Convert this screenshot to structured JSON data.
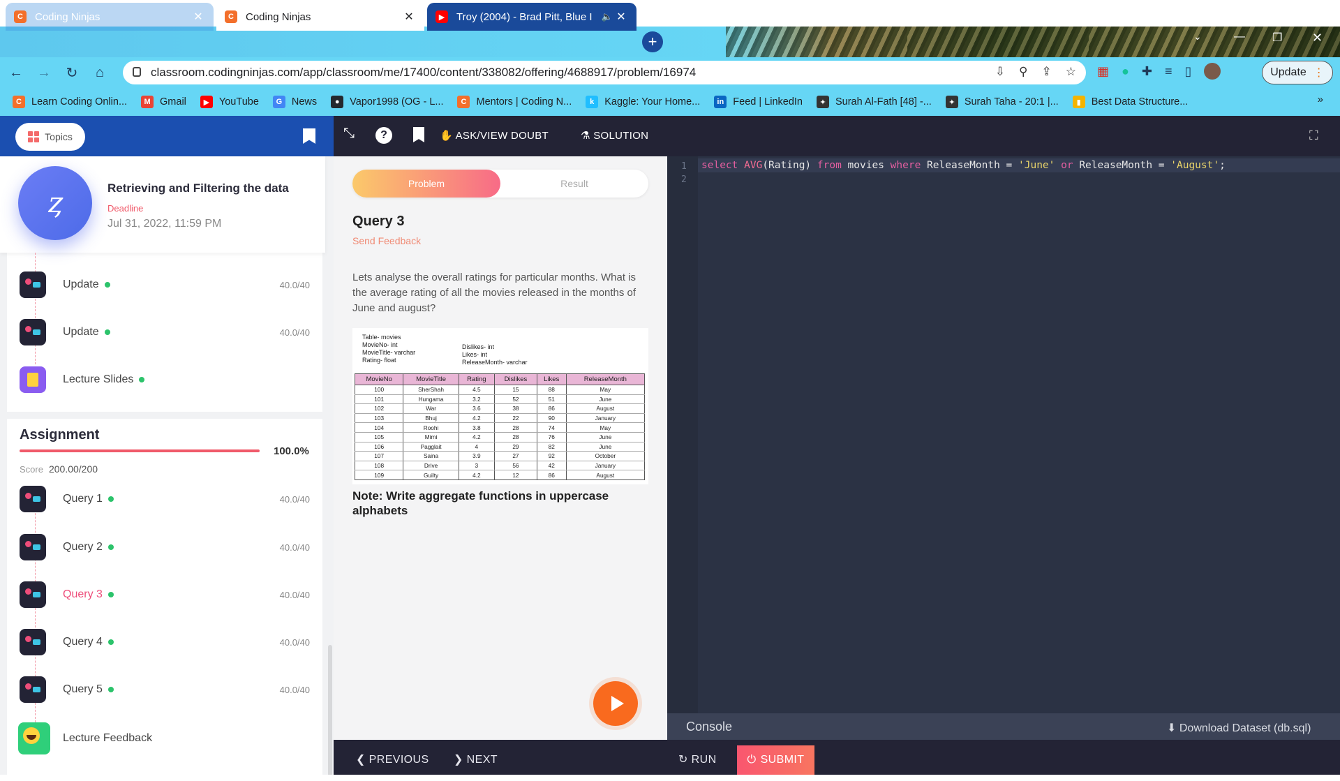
{
  "browser": {
    "tabs": [
      {
        "title": "Coding Ninjas",
        "favicon": "coding-ninjas-icon"
      },
      {
        "title": "Coding Ninjas",
        "favicon": "coding-ninjas-icon"
      },
      {
        "title": "Troy (2004) - Brad Pitt, Blue I",
        "favicon": "youtube-icon"
      }
    ],
    "url": "classroom.codingninjas.com/app/classroom/me/17400/content/338082/offering/4688917/problem/16974",
    "update_label": "Update",
    "bookmarks": [
      {
        "label": "Learn Coding Onlin...",
        "color": "#f36f2b",
        "glyph": "C"
      },
      {
        "label": "Gmail",
        "color": "#ea4335",
        "glyph": "M"
      },
      {
        "label": "YouTube",
        "color": "#ff0000",
        "glyph": "▶"
      },
      {
        "label": "News",
        "color": "#4285f4",
        "glyph": "G"
      },
      {
        "label": "Vapor1998 (OG - L...",
        "color": "#24292e",
        "glyph": "●"
      },
      {
        "label": "Mentors | Coding N...",
        "color": "#f36f2b",
        "glyph": "C"
      },
      {
        "label": "Kaggle: Your Home...",
        "color": "#20beff",
        "glyph": "k"
      },
      {
        "label": "Feed | LinkedIn",
        "color": "#0a66c2",
        "glyph": "in"
      },
      {
        "label": "Surah Al-Fath [48] -...",
        "color": "#333333",
        "glyph": "✦"
      },
      {
        "label": "Surah Taha - 20:1 |...",
        "color": "#333333",
        "glyph": "✦"
      },
      {
        "label": "Best Data Structure...",
        "color": "#f4b400",
        "glyph": "▮"
      }
    ]
  },
  "header": {
    "topics_label": "Topics",
    "ask_doubt": "ASK/VIEW DOUBT",
    "solution": "SOLUTION"
  },
  "course": {
    "title": "Retrieving and Filtering the data",
    "deadline_label": "Deadline",
    "deadline": "Jul 31, 2022, 11:59 PM"
  },
  "lecture_items": [
    {
      "label": "Update",
      "score": "40.0/40"
    },
    {
      "label": "Update",
      "score": "40.0/40"
    },
    {
      "label": "Lecture Slides",
      "score": ""
    }
  ],
  "assignment": {
    "title": "Assignment",
    "percent": "100.0%",
    "progress": 1.0,
    "score_label": "Score",
    "score": "200.00/200",
    "items": [
      {
        "label": "Query 1",
        "score": "40.0/40"
      },
      {
        "label": "Query 2",
        "score": "40.0/40"
      },
      {
        "label": "Query 3",
        "score": "40.0/40"
      },
      {
        "label": "Query 4",
        "score": "40.0/40"
      },
      {
        "label": "Query 5",
        "score": "40.0/40"
      }
    ],
    "feedback_label": "Lecture Feedback"
  },
  "problem": {
    "tab_problem": "Problem",
    "tab_result": "Result",
    "title": "Query 3",
    "send_feedback": "Send Feedback",
    "description": "Lets analyse the overall ratings for particular months. What is the average rating of all the movies released in the months of June and august?",
    "schema_left": "Table- movies\nMovieNo- int\nMovieTitle- varchar\nRating- float",
    "schema_right": "Dislikes- int\nLikes- int\nReleaseMonth- varchar",
    "table_headers": [
      "MovieNo",
      "MovieTitle",
      "Rating",
      "Dislikes",
      "Likes",
      "ReleaseMonth"
    ],
    "table_rows": [
      [
        "100",
        "SherShah",
        "4.5",
        "15",
        "88",
        "May"
      ],
      [
        "101",
        "Hungama",
        "3.2",
        "52",
        "51",
        "June"
      ],
      [
        "102",
        "War",
        "3.6",
        "38",
        "86",
        "August"
      ],
      [
        "103",
        "Bhuj",
        "4.2",
        "22",
        "90",
        "January"
      ],
      [
        "104",
        "Roohi",
        "3.8",
        "28",
        "74",
        "May"
      ],
      [
        "105",
        "Mimi",
        "4.2",
        "28",
        "76",
        "June"
      ],
      [
        "106",
        "Pagglait",
        "4",
        "29",
        "82",
        "June"
      ],
      [
        "107",
        "Saina",
        "3.9",
        "27",
        "92",
        "October"
      ],
      [
        "108",
        "Drive",
        "3",
        "56",
        "42",
        "January"
      ],
      [
        "109",
        "Guilty",
        "4.2",
        "12",
        "86",
        "August"
      ]
    ],
    "note": "Note: Write aggregate functions in uppercase alphabets"
  },
  "editor": {
    "line_numbers": [
      "1",
      "2"
    ],
    "code_tokens": [
      {
        "t": "select ",
        "c": "kw"
      },
      {
        "t": "AVG",
        "c": "fn"
      },
      {
        "t": "(Rating) ",
        "c": ""
      },
      {
        "t": "from ",
        "c": "kw"
      },
      {
        "t": "movies ",
        "c": ""
      },
      {
        "t": "where ",
        "c": "kw"
      },
      {
        "t": "ReleaseMonth = ",
        "c": ""
      },
      {
        "t": "'June' ",
        "c": "str"
      },
      {
        "t": "or ",
        "c": "kw"
      },
      {
        "t": "ReleaseMonth = ",
        "c": ""
      },
      {
        "t": "'August'",
        "c": "str"
      },
      {
        "t": ";",
        "c": ""
      }
    ],
    "console_label": "Console",
    "download_label": "Download Dataset (db.sql)"
  },
  "footer": {
    "previous": "PREVIOUS",
    "next": "NEXT",
    "run": "RUN",
    "submit": "SUBMIT"
  },
  "colors": {
    "accent": "#f05a6a",
    "header_dark": "#232335",
    "header_blue": "#1b4fb0",
    "editor_bg": "#2b3244",
    "complete_dot": "#2cc36b"
  }
}
